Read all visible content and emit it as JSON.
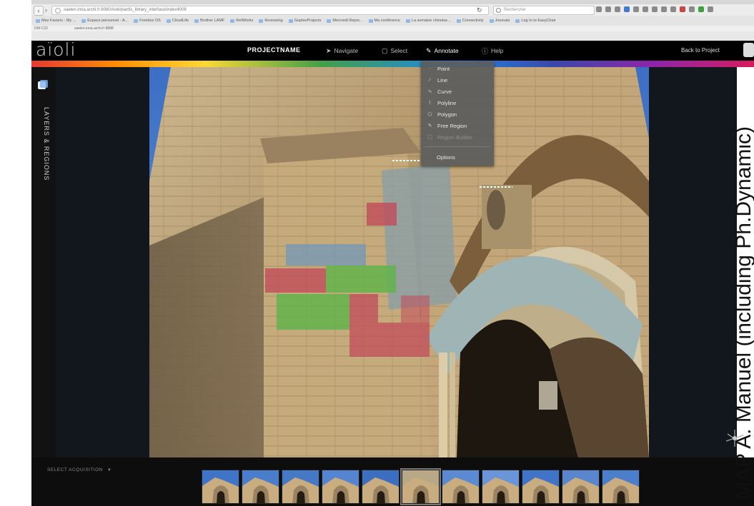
{
  "browser": {
    "url": "saelen.inria.archi.fr:8080/Aioli/pantis_library_interface/index4008",
    "search_placeholder": "Rechercher",
    "bookmarks": [
      "Mes Favoris - My ...",
      "Espace personnel - A...",
      "Freebox OS",
      "CloudLife",
      "Brother LAMF",
      "RefWorks",
      "Reviewing",
      "GepleeProjects",
      "Mercredi Repor...",
      "Ma conférence",
      "La semaine chinoise...",
      "Connectivity",
      "Journals",
      "Log In to EasyChair"
    ],
    "status_left": "DW-C32",
    "status_center": "saelen.inria.archi.fr 8888"
  },
  "app": {
    "logo": "aïoli",
    "project_name": "PROJECTNAME",
    "menu": {
      "navigate": "Navigate",
      "select": "Select",
      "annotate": "Annotate",
      "help": "Help"
    },
    "back_to_project": "Back to Project",
    "sidebar_label": "LAYERS & REGIONS",
    "select_acquisition": "SELECT ACQUISITION",
    "annotate_menu": {
      "items": [
        "Point",
        "Line",
        "Curve",
        "Polyline",
        "Polygon",
        "Free Region",
        "Region Builder"
      ],
      "options": "Options"
    },
    "colors": {
      "red_region": "#c24a5a",
      "green_region": "#5fb34a",
      "blue_region": "#7a9ab0",
      "menu_bg": "#5c5c5c",
      "app_bar": "#000000"
    }
  },
  "watermark": "MAP A. Manuel (including Ph.Dynamic)"
}
